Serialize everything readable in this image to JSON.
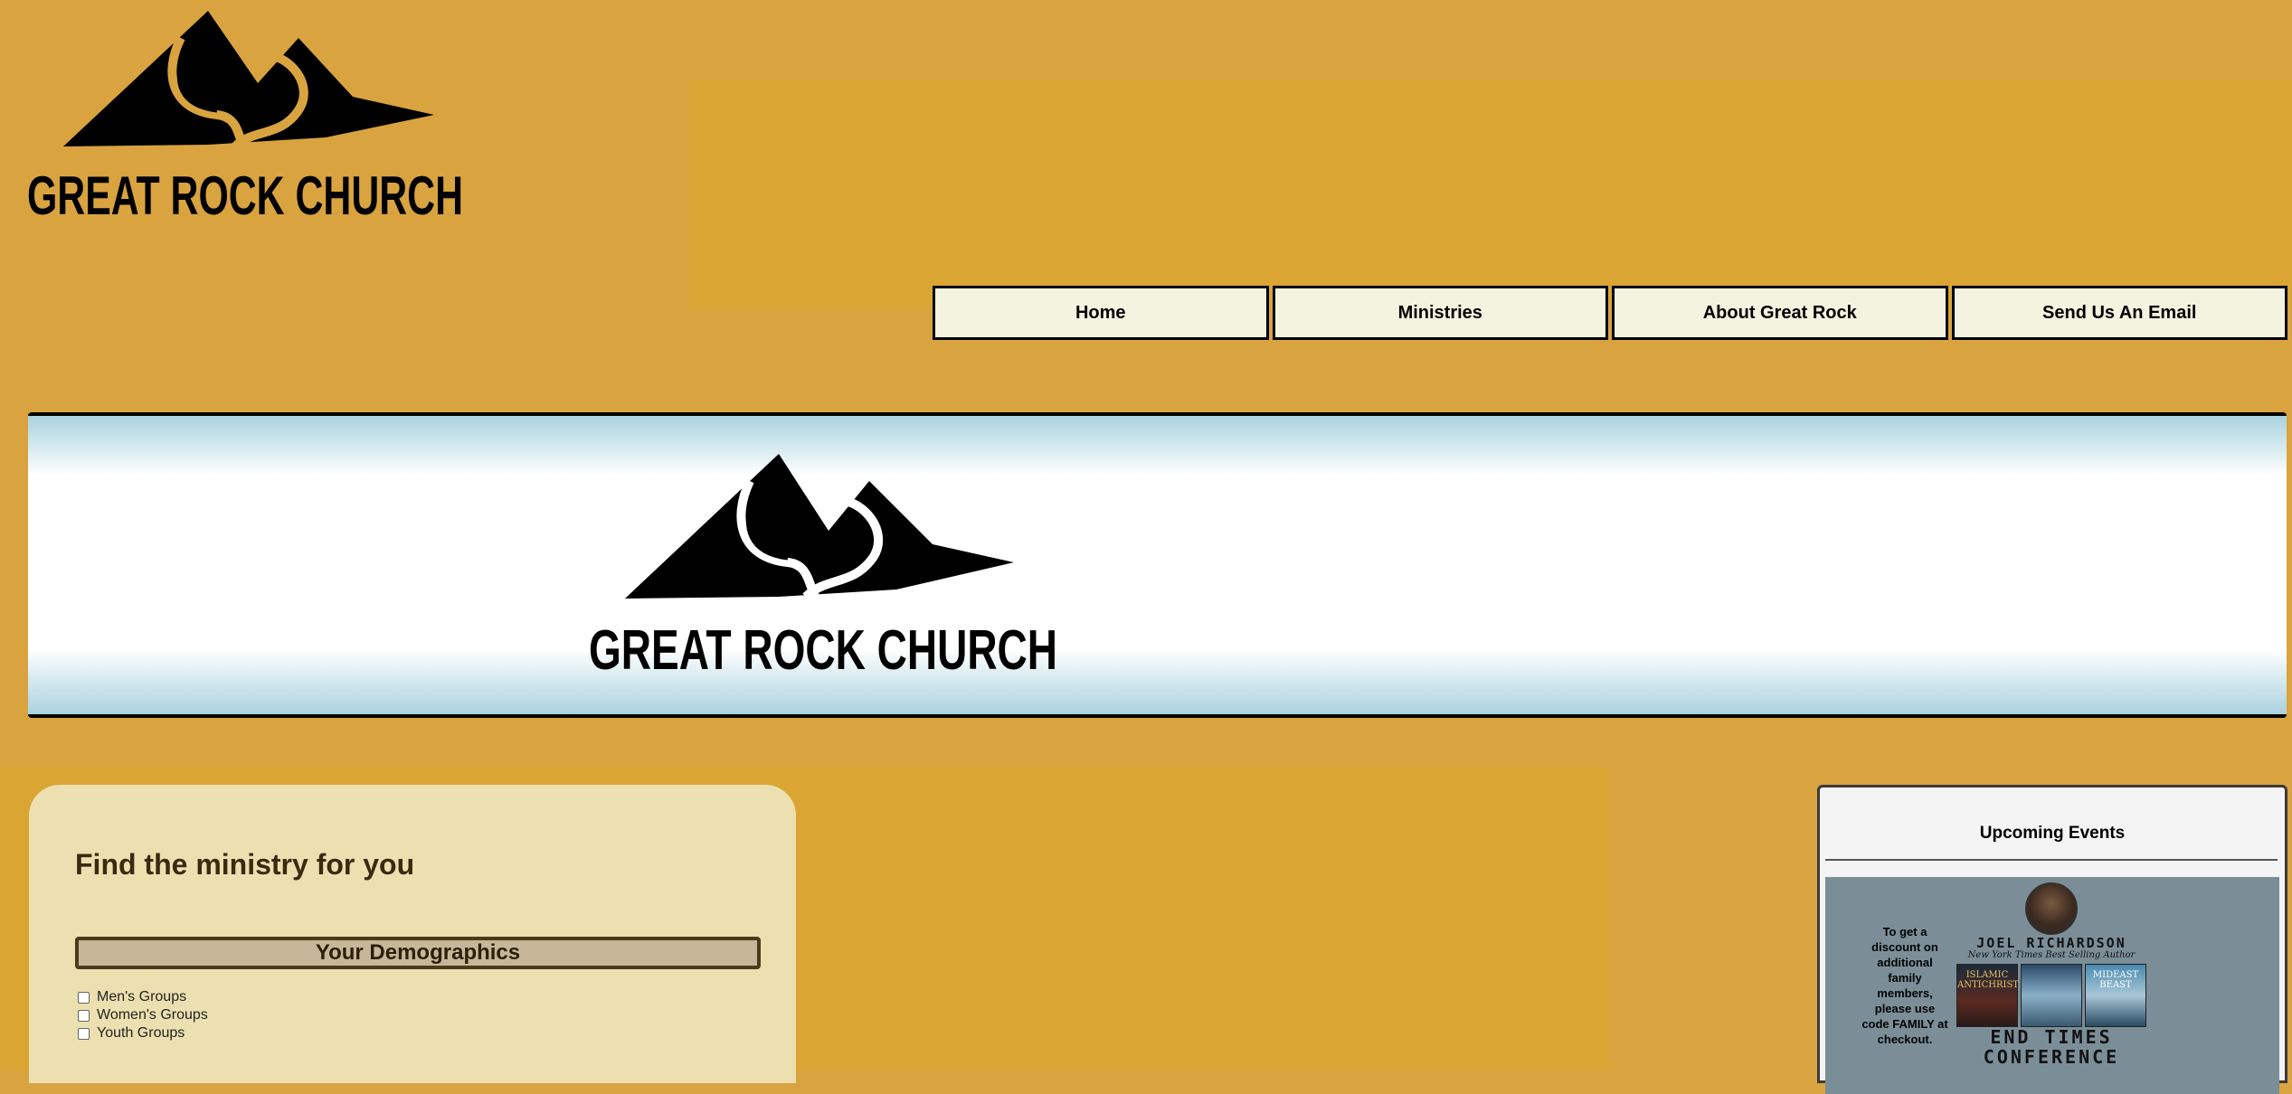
{
  "site": {
    "logo_text": "GREAT ROCK CHURCH"
  },
  "nav": {
    "items": [
      {
        "label": "Home"
      },
      {
        "label": "Ministries"
      },
      {
        "label": "About Great Rock"
      },
      {
        "label": "Send Us An Email"
      }
    ]
  },
  "banner": {
    "logo_text": "GREAT ROCK CHURCH"
  },
  "finder": {
    "title": "Find the ministry for you",
    "section_title": "Your Demographics",
    "options": [
      {
        "label": "Men's Groups",
        "checked": false
      },
      {
        "label": "Women's Groups",
        "checked": false
      },
      {
        "label": "Youth Groups",
        "checked": false
      }
    ]
  },
  "events": {
    "title": "Upcoming Events",
    "promo": {
      "discount_text": "To get a discount on additional family members, please use code FAMILY at checkout.",
      "author_name": "JOEL RICHARDSON",
      "author_tagline": "New York Times Best Selling Author",
      "books": [
        {
          "title": "ISLAMIC ANTICHRIST"
        },
        {
          "title": ""
        },
        {
          "title": "MIDEAST BEAST"
        }
      ],
      "event_name": "END TIMES CONFERENCE"
    }
  },
  "colors": {
    "page_background": "#d9a33f",
    "header_band": "#dba534",
    "nav_button": "#f4f3df",
    "finder_panel": "#ede0b0",
    "demographics_bar": "#c6b798",
    "events_panel": "#f4f4f4",
    "promo_background": "#7b8e98"
  }
}
